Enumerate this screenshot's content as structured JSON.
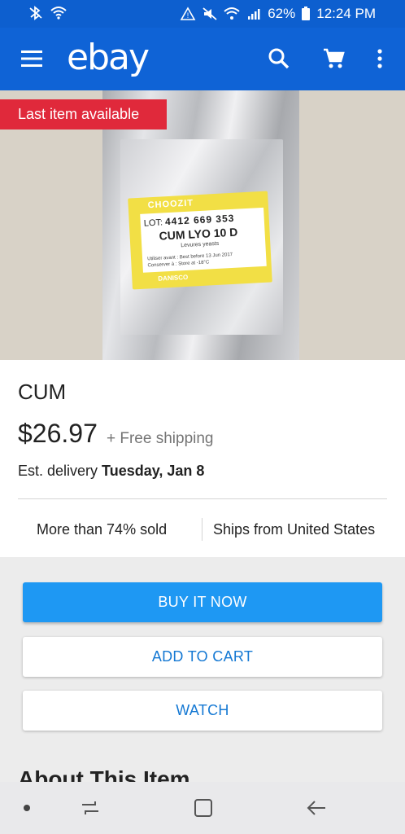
{
  "status_bar": {
    "battery": "62%",
    "time": "12:24 PM"
  },
  "app_bar": {
    "logo": "ebay",
    "icons": [
      "menu-icon",
      "search-icon",
      "cart-icon",
      "more-vert-icon"
    ]
  },
  "hero": {
    "badge": "Last item available",
    "product_label": {
      "brand": "CHOOZIT",
      "lot_prefix": "LOT:",
      "lot_number": "4412 669 353",
      "name": "CUM LYO 10 D",
      "sub": "Levures  yeasts",
      "best_before_line": "Utiliser avant : Best before  13 Jun 2017",
      "store_line": "Conserver à : Store at  -18°C",
      "maker": "DANISCO"
    }
  },
  "listing": {
    "title": "CUM",
    "price": "$26.97",
    "shipping": "+ Free shipping",
    "delivery_prefix": "Est. delivery ",
    "delivery_date": "Tuesday, Jan 8",
    "sold_stat": "More than 74% sold",
    "ships_from": "Ships from United States"
  },
  "actions": {
    "buy_now": "BUY IT NOW",
    "add_to_cart": "ADD TO CART",
    "watch": "WATCH"
  },
  "section": {
    "about_heading": "About This Item"
  },
  "colors": {
    "app_bar": "#0f63d6",
    "badge": "#e0293b",
    "primary_button": "#1e98f3",
    "link_text": "#1478d3"
  }
}
